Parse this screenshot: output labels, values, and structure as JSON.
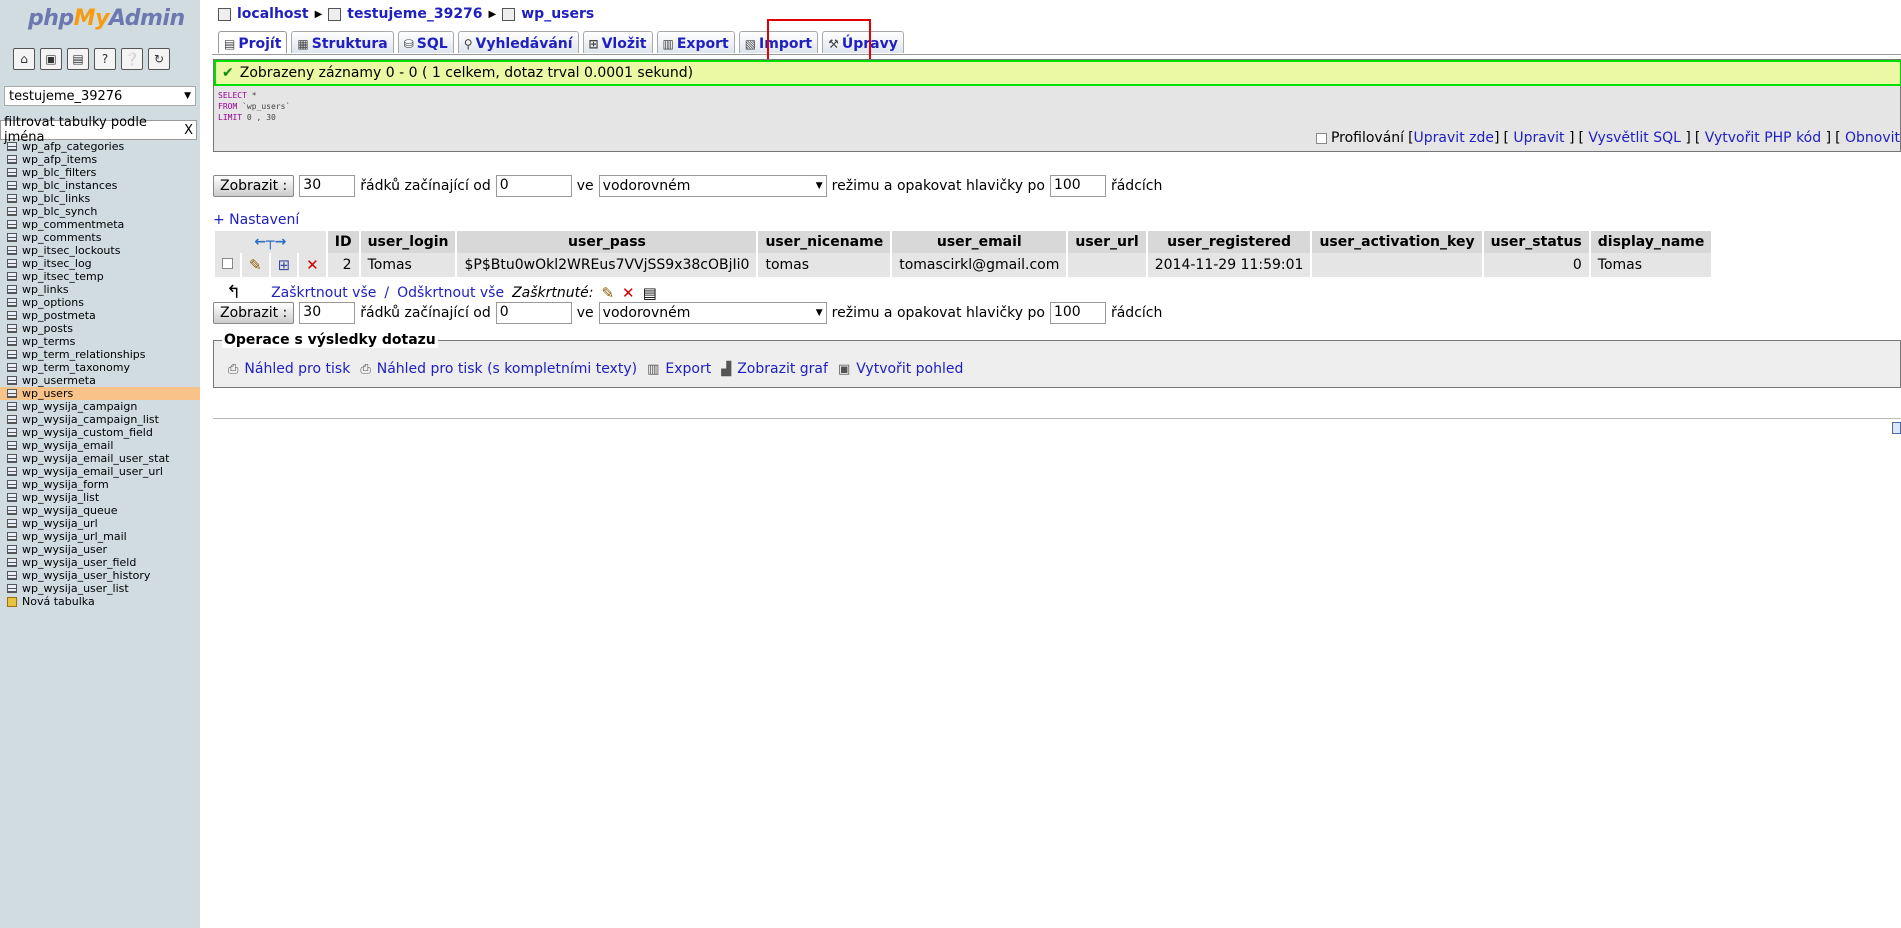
{
  "sidebar": {
    "logo": {
      "php": "php",
      "my": "My",
      "admin": "Admin"
    },
    "icons": [
      "home-icon",
      "query-window-icon",
      "sql-docs-icon",
      "docs-icon",
      "mysql-docs-icon",
      "reload-icon"
    ],
    "database": "testujeme_39276",
    "filter_placeholder": "filtrovat tabulky podle jména",
    "filter_clear": "X",
    "tables": [
      "wp_afp_categories",
      "wp_afp_items",
      "wp_blc_filters",
      "wp_blc_instances",
      "wp_blc_links",
      "wp_blc_synch",
      "wp_commentmeta",
      "wp_comments",
      "wp_itsec_lockouts",
      "wp_itsec_log",
      "wp_itsec_temp",
      "wp_links",
      "wp_options",
      "wp_postmeta",
      "wp_posts",
      "wp_terms",
      "wp_term_relationships",
      "wp_term_taxonomy",
      "wp_usermeta",
      "wp_users",
      "wp_wysija_campaign",
      "wp_wysija_campaign_list",
      "wp_wysija_custom_field",
      "wp_wysija_email",
      "wp_wysija_email_user_stat",
      "wp_wysija_email_user_url",
      "wp_wysija_form",
      "wp_wysija_list",
      "wp_wysija_queue",
      "wp_wysija_url",
      "wp_wysija_url_mail",
      "wp_wysija_user",
      "wp_wysija_user_field",
      "wp_wysija_user_history",
      "wp_wysija_user_list"
    ],
    "active_table": "wp_users",
    "new_table": "Nová tabulka"
  },
  "breadcrumb": {
    "server": "localhost",
    "database": "testujeme_39276",
    "table": "wp_users"
  },
  "tabs": [
    {
      "label": "Projít",
      "icon": "browse-icon",
      "active": true
    },
    {
      "label": "Struktura",
      "icon": "structure-icon",
      "active": false
    },
    {
      "label": "SQL",
      "icon": "sql-icon",
      "active": false
    },
    {
      "label": "Vyhledávání",
      "icon": "search-icon",
      "active": false
    },
    {
      "label": "Vložit",
      "icon": "insert-icon",
      "active": false
    },
    {
      "label": "Export",
      "icon": "export-icon",
      "active": false
    },
    {
      "label": "Import",
      "icon": "import-icon",
      "active": false
    },
    {
      "label": "Úpravy",
      "icon": "operations-icon",
      "active": false
    }
  ],
  "result": {
    "message": "Zobrazeny záznamy 0 - 0 ( 1 celkem, dotaz trval 0.0001 sekund)",
    "sql": {
      "select": "SELECT",
      "star": "*",
      "from": "FROM",
      "table": "`wp_users`",
      "limit": "LIMIT",
      "limit_val": "0 , 30"
    },
    "profiling_label": "Profilování",
    "links": [
      "Upravit zde",
      "Upravit",
      "Vysvětlit SQL",
      "Vytvořit PHP kód",
      "Obnovit"
    ]
  },
  "navigation": {
    "show_button": "Zobrazit :",
    "rows": "30",
    "rows_label": "řádků začínající od",
    "start": "0",
    "in_label": "ve",
    "mode": "vodorovném",
    "mode_label": "režimu a opakovat hlavičky po",
    "repeat": "100",
    "repeat_label": "řádcích"
  },
  "settings_link": "+ Nastavení",
  "table": {
    "columns": [
      "ID",
      "user_login",
      "user_pass",
      "user_nicename",
      "user_email",
      "user_url",
      "user_registered",
      "user_activation_key",
      "user_status",
      "display_name"
    ],
    "rows": [
      {
        "ID": "2",
        "user_login": "Tomas",
        "user_pass": "$P$Btu0wOkl2WREus7VVjSS9x38cOBjIi0",
        "user_nicename": "tomas",
        "user_email": "tomascirkl@gmail.com",
        "user_url": "",
        "user_registered": "2014-11-29 11:59:01",
        "user_activation_key": "",
        "user_status": "0",
        "display_name": "Tomas"
      }
    ]
  },
  "check_all": {
    "label": "Zaškrtnout vše",
    "separator": "/",
    "uncheck": "Odškrtnout vše",
    "with_selected": "Zaškrtnuté:"
  },
  "operations": {
    "legend": "Operace s výsledky dotazu",
    "links": [
      {
        "label": "Náhled pro tisk",
        "icon": "print-icon"
      },
      {
        "label": "Náhled pro tisk (s kompletními texty)",
        "icon": "print-full-icon"
      },
      {
        "label": "Export",
        "icon": "export-icon"
      },
      {
        "label": "Zobrazit graf",
        "icon": "chart-icon"
      },
      {
        "label": "Vytvořit pohled",
        "icon": "view-icon"
      }
    ]
  },
  "colors": {
    "sidebar_bg": "#d0dce0",
    "active_row": "#f8c388",
    "success_border": "#00dd00",
    "link": "#2020c0",
    "highlight": "#e00000"
  }
}
